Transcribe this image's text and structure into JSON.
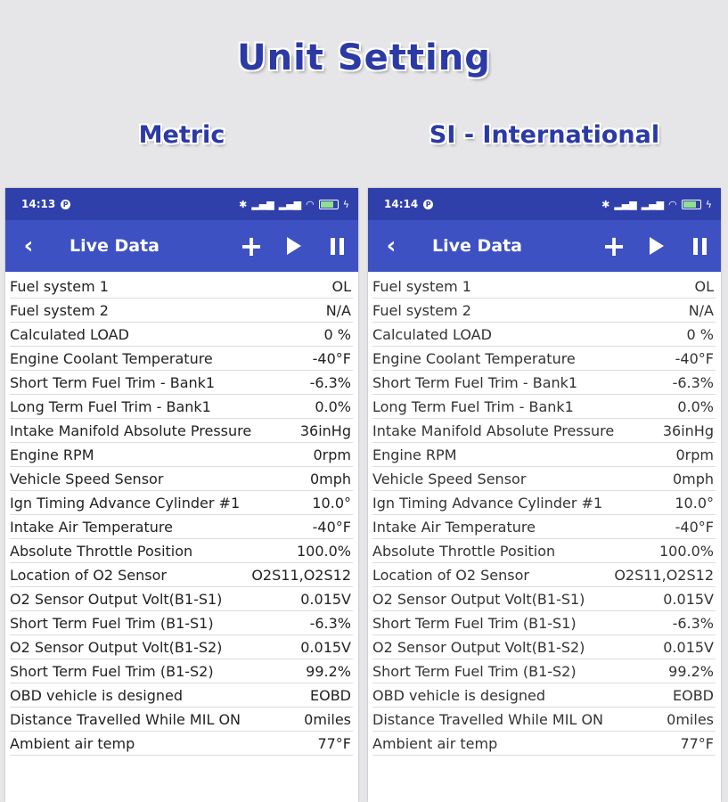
{
  "header": {
    "title": "Unit Setting",
    "left_subtitle": "Metric",
    "right_subtitle": "SI - International"
  },
  "colors": {
    "accent": "#3d51c3",
    "statusbar": "#3040ab",
    "title": "#2b3aa5"
  },
  "left_phone": {
    "status": {
      "time": "14:13",
      "p_icon": "P"
    },
    "appbar": {
      "title": "Live Data",
      "back_icon": "chevron-left-icon",
      "add_icon": "plus-icon",
      "play_icon": "play-icon",
      "pause_icon": "pause-icon"
    },
    "rows": [
      {
        "label": "Fuel system 1",
        "value": "OL"
      },
      {
        "label": "Fuel system 2",
        "value": "N/A"
      },
      {
        "label": "Calculated LOAD",
        "value": "0 %"
      },
      {
        "label": "Engine Coolant Temperature",
        "value": "-40°F"
      },
      {
        "label": "Short Term Fuel Trim - Bank1",
        "value": "-6.3%"
      },
      {
        "label": "Long Term Fuel Trim - Bank1",
        "value": "0.0%"
      },
      {
        "label": "Intake Manifold Absolute Pressure",
        "value": "36inHg"
      },
      {
        "label": "Engine RPM",
        "value": "0rpm"
      },
      {
        "label": "Vehicle Speed Sensor",
        "value": "0mph"
      },
      {
        "label": "Ign Timing Advance Cylinder #1",
        "value": "10.0°"
      },
      {
        "label": "Intake Air Temperature",
        "value": "-40°F"
      },
      {
        "label": "Absolute Throttle Position",
        "value": "100.0%"
      },
      {
        "label": "Location of O2 Sensor",
        "value": "O2S11,O2S12"
      },
      {
        "label": "O2 Sensor Output Volt(B1-S1)",
        "value": "0.015V"
      },
      {
        "label": "Short Term Fuel Trim (B1-S1)",
        "value": "-6.3%"
      },
      {
        "label": "O2 Sensor Output Volt(B1-S2)",
        "value": "0.015V"
      },
      {
        "label": "Short Term Fuel Trim (B1-S2)",
        "value": "99.2%"
      },
      {
        "label": "OBD vehicle is designed",
        "value": "EOBD"
      },
      {
        "label": "Distance Travelled While MIL ON",
        "value": "0miles"
      },
      {
        "label": "Ambient air temp",
        "value": "77°F"
      }
    ]
  },
  "right_phone": {
    "status": {
      "time": "14:14",
      "p_icon": "P"
    },
    "appbar": {
      "title": "Live Data",
      "back_icon": "chevron-left-icon",
      "add_icon": "plus-icon",
      "play_icon": "play-icon",
      "pause_icon": "pause-icon"
    },
    "rows": [
      {
        "label": "Fuel system 1",
        "value": "OL"
      },
      {
        "label": "Fuel system 2",
        "value": "N/A"
      },
      {
        "label": "Calculated LOAD",
        "value": "0 %"
      },
      {
        "label": "Engine Coolant Temperature",
        "value": "-40°F"
      },
      {
        "label": "Short Term Fuel Trim - Bank1",
        "value": "-6.3%"
      },
      {
        "label": "Long Term Fuel Trim - Bank1",
        "value": "0.0%"
      },
      {
        "label": "Intake Manifold Absolute Pressure",
        "value": "36inHg"
      },
      {
        "label": "Engine RPM",
        "value": "0rpm"
      },
      {
        "label": "Vehicle Speed Sensor",
        "value": "0mph"
      },
      {
        "label": "Ign Timing Advance Cylinder #1",
        "value": "10.0°"
      },
      {
        "label": "Intake Air Temperature",
        "value": "-40°F"
      },
      {
        "label": "Absolute Throttle Position",
        "value": "100.0%"
      },
      {
        "label": "Location of O2 Sensor",
        "value": "O2S11,O2S12"
      },
      {
        "label": "O2 Sensor Output Volt(B1-S1)",
        "value": "0.015V"
      },
      {
        "label": "Short Term Fuel Trim (B1-S1)",
        "value": "-6.3%"
      },
      {
        "label": "O2 Sensor Output Volt(B1-S2)",
        "value": "0.015V"
      },
      {
        "label": "Short Term Fuel Trim (B1-S2)",
        "value": "99.2%"
      },
      {
        "label": "OBD vehicle is designed",
        "value": "EOBD"
      },
      {
        "label": "Distance Travelled While MIL ON",
        "value": "0miles"
      },
      {
        "label": "Ambient air temp",
        "value": "77°F"
      }
    ]
  }
}
